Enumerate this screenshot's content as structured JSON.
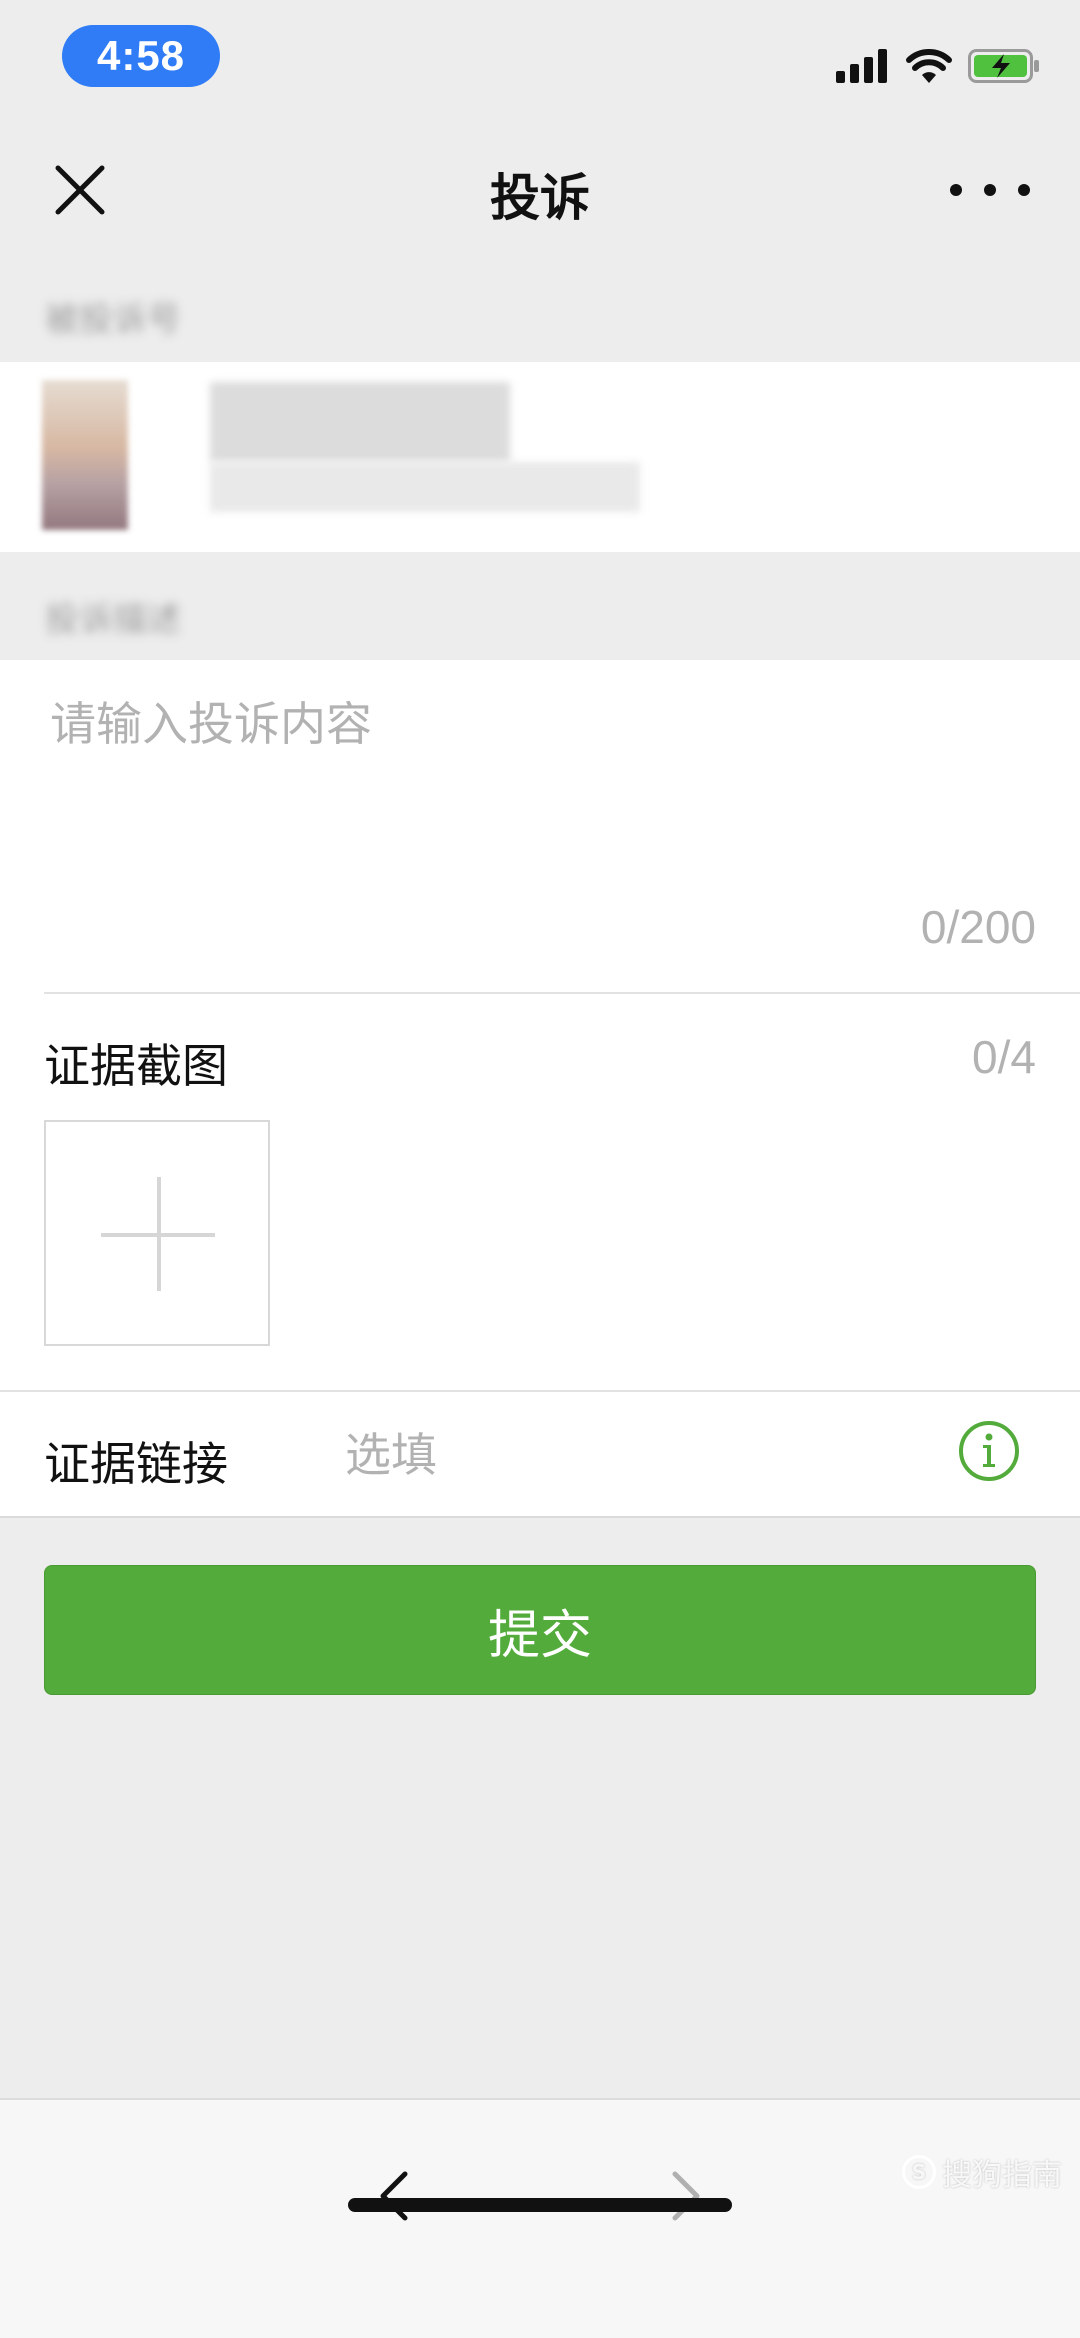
{
  "status_bar": {
    "time": "4:58",
    "icons": [
      "signal-icon",
      "wifi-icon",
      "battery-charging-icon"
    ]
  },
  "nav": {
    "title": "投诉",
    "close_icon": "close-icon",
    "more_icon": "more-icon"
  },
  "section_account": {
    "header": "被投诉号"
  },
  "section_description": {
    "header": "投诉描述",
    "placeholder": "请输入投诉内容",
    "counter": "0/200"
  },
  "evidence": {
    "screenshot_label": "证据截图",
    "screenshot_count": "0/4",
    "link_label": "证据链接",
    "link_placeholder": "选填",
    "info_icon": "info-icon"
  },
  "submit": {
    "label": "提交"
  },
  "bottom_bar": {
    "back_icon": "chevron-left-icon",
    "forward_icon": "chevron-right-icon"
  },
  "watermark": {
    "text": "搜狗指南"
  },
  "colors": {
    "accent": "#53ab3b",
    "page_background": "#ededed",
    "time_pill": "#2f7cf6",
    "placeholder": "#b2b2b2"
  }
}
